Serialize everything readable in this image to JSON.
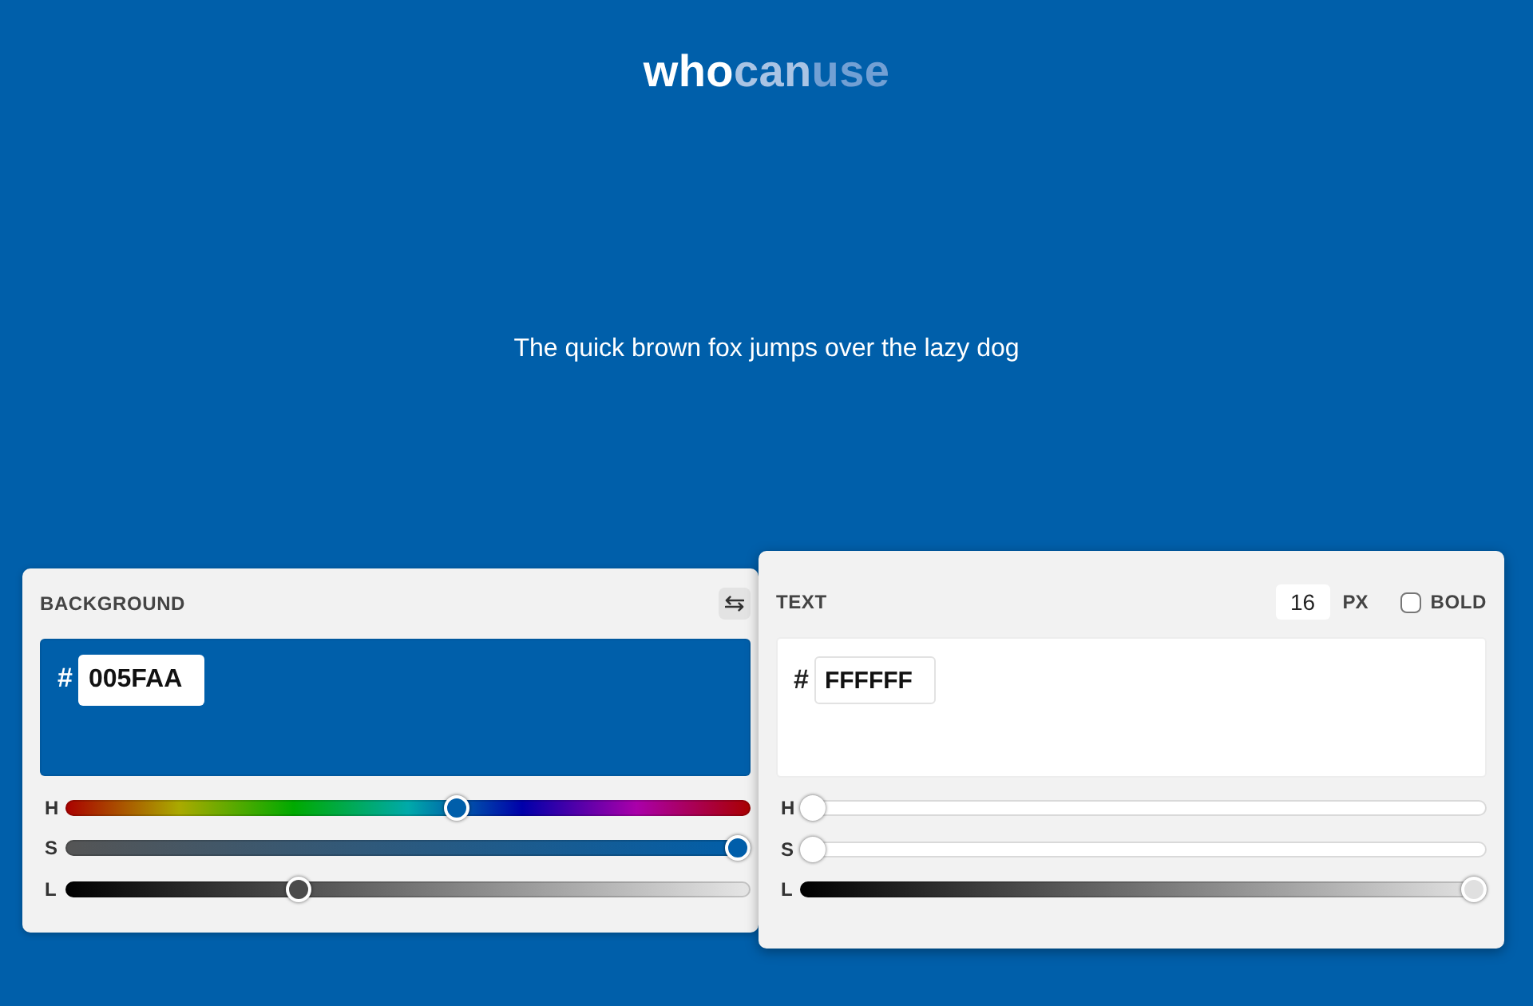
{
  "logo": [
    {
      "text": "who",
      "color": "#ffffff"
    },
    {
      "text": "can",
      "color": "#a9c4e4"
    },
    {
      "text": "use",
      "color": "#72a0d4"
    }
  ],
  "sample_text": "The quick brown fox jumps over the lazy dog",
  "panels": [
    {
      "kind": "background",
      "title": "BACKGROUND",
      "color": "#005faa",
      "hash": "#",
      "hex": "005FAA",
      "sliders": [
        {
          "kind": "hue",
          "label": "H",
          "level": 0.574
        },
        {
          "kind": "saturation",
          "label": "S",
          "level": 1
        },
        {
          "kind": "lightness",
          "label": "L",
          "level": 0.333
        }
      ]
    },
    {
      "kind": "text",
      "title": "TEXT",
      "size": "16",
      "unit": "PX",
      "bold": {
        "label": "BOLD",
        "checked": false
      },
      "color": "#ffffff",
      "hash": "#",
      "hex": "FFFFFF",
      "sliders": [
        {
          "kind": "hue",
          "label": "H",
          "level": 0
        },
        {
          "kind": "saturation",
          "label": "S",
          "level": 0
        },
        {
          "kind": "lightness",
          "label": "L",
          "level": 1
        }
      ]
    }
  ]
}
